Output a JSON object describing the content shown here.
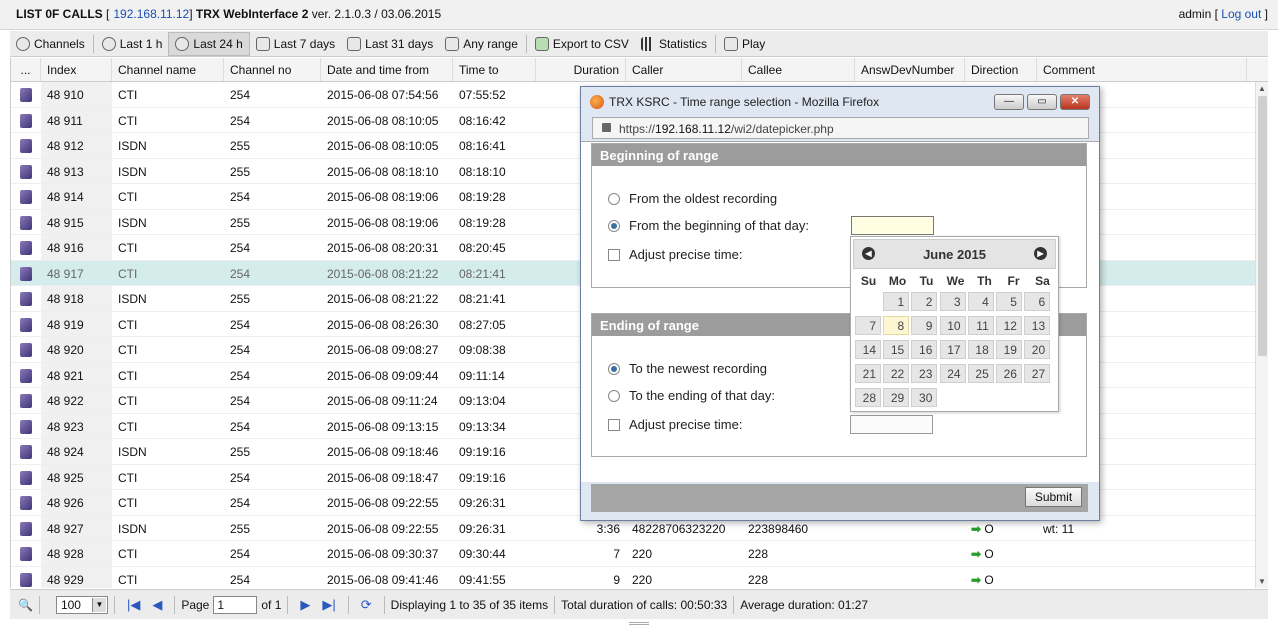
{
  "header": {
    "title": "LIST 0F CALLS",
    "ip": "192.168.11.12",
    "app": "TRX WebInterface 2",
    "version": "ver. 2.1.0.3 / 03.06.2015",
    "user": "admin",
    "logout": "Log out"
  },
  "toolbar": [
    "Channels",
    "Last 1 h",
    "Last 24 h",
    "Last 7 days",
    "Last 31 days",
    "Any range",
    "Export to CSV",
    "Statistics",
    "Play"
  ],
  "columns": [
    "...",
    "Index",
    "Channel name",
    "Channel no",
    "Date and time from",
    "Time to",
    "Duration",
    "Caller",
    "Callee",
    "AnswDevNumber",
    "Direction",
    "Comment"
  ],
  "rows": [
    [
      "48 910",
      "CTI",
      "254",
      "2015-06-08 07:54:56",
      "07:55:52",
      "",
      "",
      "",
      "",
      "",
      ""
    ],
    [
      "48 911",
      "CTI",
      "254",
      "2015-06-08 08:10:05",
      "08:16:42",
      "",
      "",
      "",
      "",
      "",
      ""
    ],
    [
      "48 912",
      "ISDN",
      "255",
      "2015-06-08 08:10:05",
      "08:16:41",
      "",
      "",
      "",
      "",
      "",
      ""
    ],
    [
      "48 913",
      "ISDN",
      "255",
      "2015-06-08 08:18:10",
      "08:18:10",
      "",
      "",
      "",
      "",
      "",
      ""
    ],
    [
      "48 914",
      "CTI",
      "254",
      "2015-06-08 08:19:06",
      "08:19:28",
      "",
      "",
      "",
      "",
      "",
      ""
    ],
    [
      "48 915",
      "ISDN",
      "255",
      "2015-06-08 08:19:06",
      "08:19:28",
      "",
      "",
      "",
      "",
      "",
      ""
    ],
    [
      "48 916",
      "CTI",
      "254",
      "2015-06-08 08:20:31",
      "08:20:45",
      "",
      "",
      "",
      "",
      "",
      ""
    ],
    [
      "48 917",
      "CTI",
      "254",
      "2015-06-08 08:21:22",
      "08:21:41",
      "",
      "",
      "",
      "",
      "",
      ""
    ],
    [
      "48 918",
      "ISDN",
      "255",
      "2015-06-08 08:21:22",
      "08:21:41",
      "",
      "",
      "",
      "",
      "",
      ""
    ],
    [
      "48 919",
      "CTI",
      "254",
      "2015-06-08 08:26:30",
      "08:27:05",
      "",
      "",
      "",
      "",
      "",
      ""
    ],
    [
      "48 920",
      "CTI",
      "254",
      "2015-06-08 09:08:27",
      "09:08:38",
      "",
      "",
      "",
      "",
      "",
      ""
    ],
    [
      "48 921",
      "CTI",
      "254",
      "2015-06-08 09:09:44",
      "09:11:14",
      "",
      "",
      "",
      "",
      "",
      ""
    ],
    [
      "48 922",
      "CTI",
      "254",
      "2015-06-08 09:11:24",
      "09:13:04",
      "",
      "",
      "",
      "",
      "",
      ""
    ],
    [
      "48 923",
      "CTI",
      "254",
      "2015-06-08 09:13:15",
      "09:13:34",
      "",
      "",
      "",
      "",
      "",
      ""
    ],
    [
      "48 924",
      "ISDN",
      "255",
      "2015-06-08 09:18:46",
      "09:19:16",
      "",
      "",
      "",
      "",
      "",
      ""
    ],
    [
      "48 925",
      "CTI",
      "254",
      "2015-06-08 09:18:47",
      "09:19:16",
      "",
      "",
      "",
      "",
      "",
      ""
    ],
    [
      "48 926",
      "CTI",
      "254",
      "2015-06-08 09:22:55",
      "09:26:31",
      "",
      "",
      "",
      "",
      "",
      ""
    ],
    [
      "48 927",
      "ISDN",
      "255",
      "2015-06-08 09:22:55",
      "09:26:31",
      "3:36",
      "48228706323220",
      "223898460",
      "",
      "O",
      "wt: 11"
    ],
    [
      "48 928",
      "CTI",
      "254",
      "2015-06-08 09:30:37",
      "09:30:44",
      "7",
      "220",
      "228",
      "",
      "O",
      ""
    ],
    [
      "48 929",
      "CTI",
      "254",
      "2015-06-08 09:41:46",
      "09:41:55",
      "9",
      "220",
      "228",
      "",
      "O",
      ""
    ]
  ],
  "footer": {
    "page_size": "100",
    "page_label": "Page",
    "page": "1",
    "of": "of 1",
    "displaying": "Displaying 1 to 35 of 35 items",
    "total": "Total duration of calls: 00:50:33",
    "average": "Average duration: 01:27"
  },
  "dialog": {
    "title": "TRX KSRC - Time range selection - Mozilla Firefox",
    "url_prefix": "https://",
    "url_host": "192.168.11.12",
    "url_path": "/wi2/datepicker.php",
    "begin_header": "Beginning of range",
    "begin_opt1": "From the oldest recording",
    "begin_opt2": "From the beginning of that day:",
    "begin_adjust": "Adjust precise time:",
    "end_header": "Ending of range",
    "end_opt1": "To the newest recording",
    "end_opt2": "To the ending of that day:",
    "end_adjust": "Adjust precise time:",
    "submit": "Submit"
  },
  "calendar": {
    "month": "June 2015",
    "dow": [
      "Su",
      "Mo",
      "Tu",
      "We",
      "Th",
      "Fr",
      "Sa"
    ],
    "weeks": [
      [
        "",
        "1",
        "2",
        "3",
        "4",
        "5",
        "6"
      ],
      [
        "7",
        "8",
        "9",
        "10",
        "11",
        "12",
        "13"
      ],
      [
        "14",
        "15",
        "16",
        "17",
        "18",
        "19",
        "20"
      ],
      [
        "21",
        "22",
        "23",
        "24",
        "25",
        "26",
        "27"
      ],
      [
        "28",
        "29",
        "30",
        "",
        "",
        "",
        ""
      ]
    ],
    "today": "8"
  }
}
